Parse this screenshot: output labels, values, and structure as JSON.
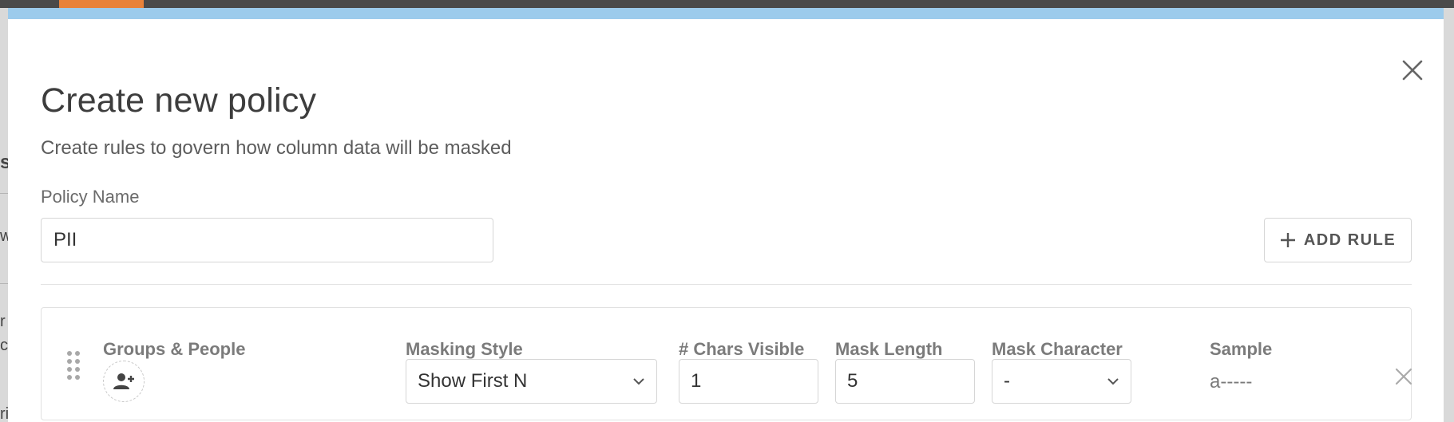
{
  "modal": {
    "title": "Create new policy",
    "subtitle": "Create rules to govern how column data will be masked",
    "policy_name_label": "Policy Name",
    "policy_name_value": "PII",
    "add_rule_label": "ADD RULE",
    "close_icon": "close-icon",
    "add_icon": "plus-icon"
  },
  "rule": {
    "groups_label": "Groups & People",
    "add_person_icon": "person-add-icon",
    "masking_style_label": "Masking Style",
    "masking_style_value": "Show First N",
    "chars_visible_label": "# Chars Visible",
    "chars_visible_value": "1",
    "mask_length_label": "Mask Length",
    "mask_length_value": "5",
    "mask_character_label": "Mask Character",
    "mask_character_value": "-",
    "sample_label": "Sample",
    "sample_value": "a-----"
  },
  "background": {
    "fragments": [
      "s",
      "w",
      "r",
      "c",
      "ri"
    ]
  },
  "colors": {
    "accent_bar": "#9ccbec",
    "logo": "#e8823a",
    "topbar": "#4a4a4a"
  }
}
